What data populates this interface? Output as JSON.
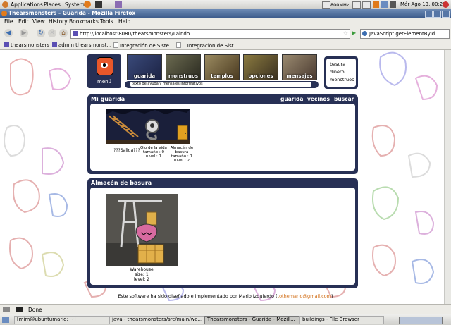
{
  "top_panel": {
    "menus": [
      "Applications",
      "Places",
      "System"
    ],
    "cpu": "800MHz",
    "clock": "Mér Ago 13, 00:22"
  },
  "window": {
    "title": "Thearsmonsters - Guarida - Mozilla Firefox"
  },
  "menubar": [
    "File",
    "Edit",
    "View",
    "History",
    "Bookmarks",
    "Tools",
    "Help"
  ],
  "navbar": {
    "url": "http://localhost:8080/thearsmonsters/Lair.do",
    "search": "JavaScript getElementById"
  },
  "bookmarks": [
    "thearsmonsters",
    "admin thearsmonst...",
    "Integración de Siste...",
    ".: Integración de Sist..."
  ],
  "page": {
    "menu_label": "menú",
    "nav": [
      "guarida",
      "monstruos",
      "templos",
      "opciones",
      "mensajes"
    ],
    "help_text": "texto de ayuda y mensajes informativos",
    "resources": [
      "basura",
      "dinero",
      "monstruos"
    ],
    "lair_panel": {
      "title": "Mi guarida",
      "links": [
        "guarida",
        "vecinos",
        "buscar"
      ],
      "rooms": [
        {
          "name": "???Salida???"
        },
        {
          "name": "Ojo de la vida",
          "line2": "tamaño : 0",
          "line3": "nivel : 1"
        },
        {
          "name": "Almacén de",
          "line2": "basura",
          "line3": "tamaño : 1",
          "line4": "nivel : 2"
        }
      ]
    },
    "storage_panel": {
      "title": "Almacén de basura",
      "name": "Warehouse",
      "size": "size: 1",
      "level": "level: 2"
    },
    "footer": "Este software ha sido diseñado e implementado por Mario Izquierdo (",
    "footer_email": "tothemario@gmail.com",
    "footer_end": ")"
  },
  "status": "Done",
  "taskbar": [
    "[mim@ubuntumario: ~]",
    "java - thearsmonsters/src/main/we...",
    "Thearsmonsters - Guarida - Mozill...",
    "buildings - File Browser"
  ]
}
